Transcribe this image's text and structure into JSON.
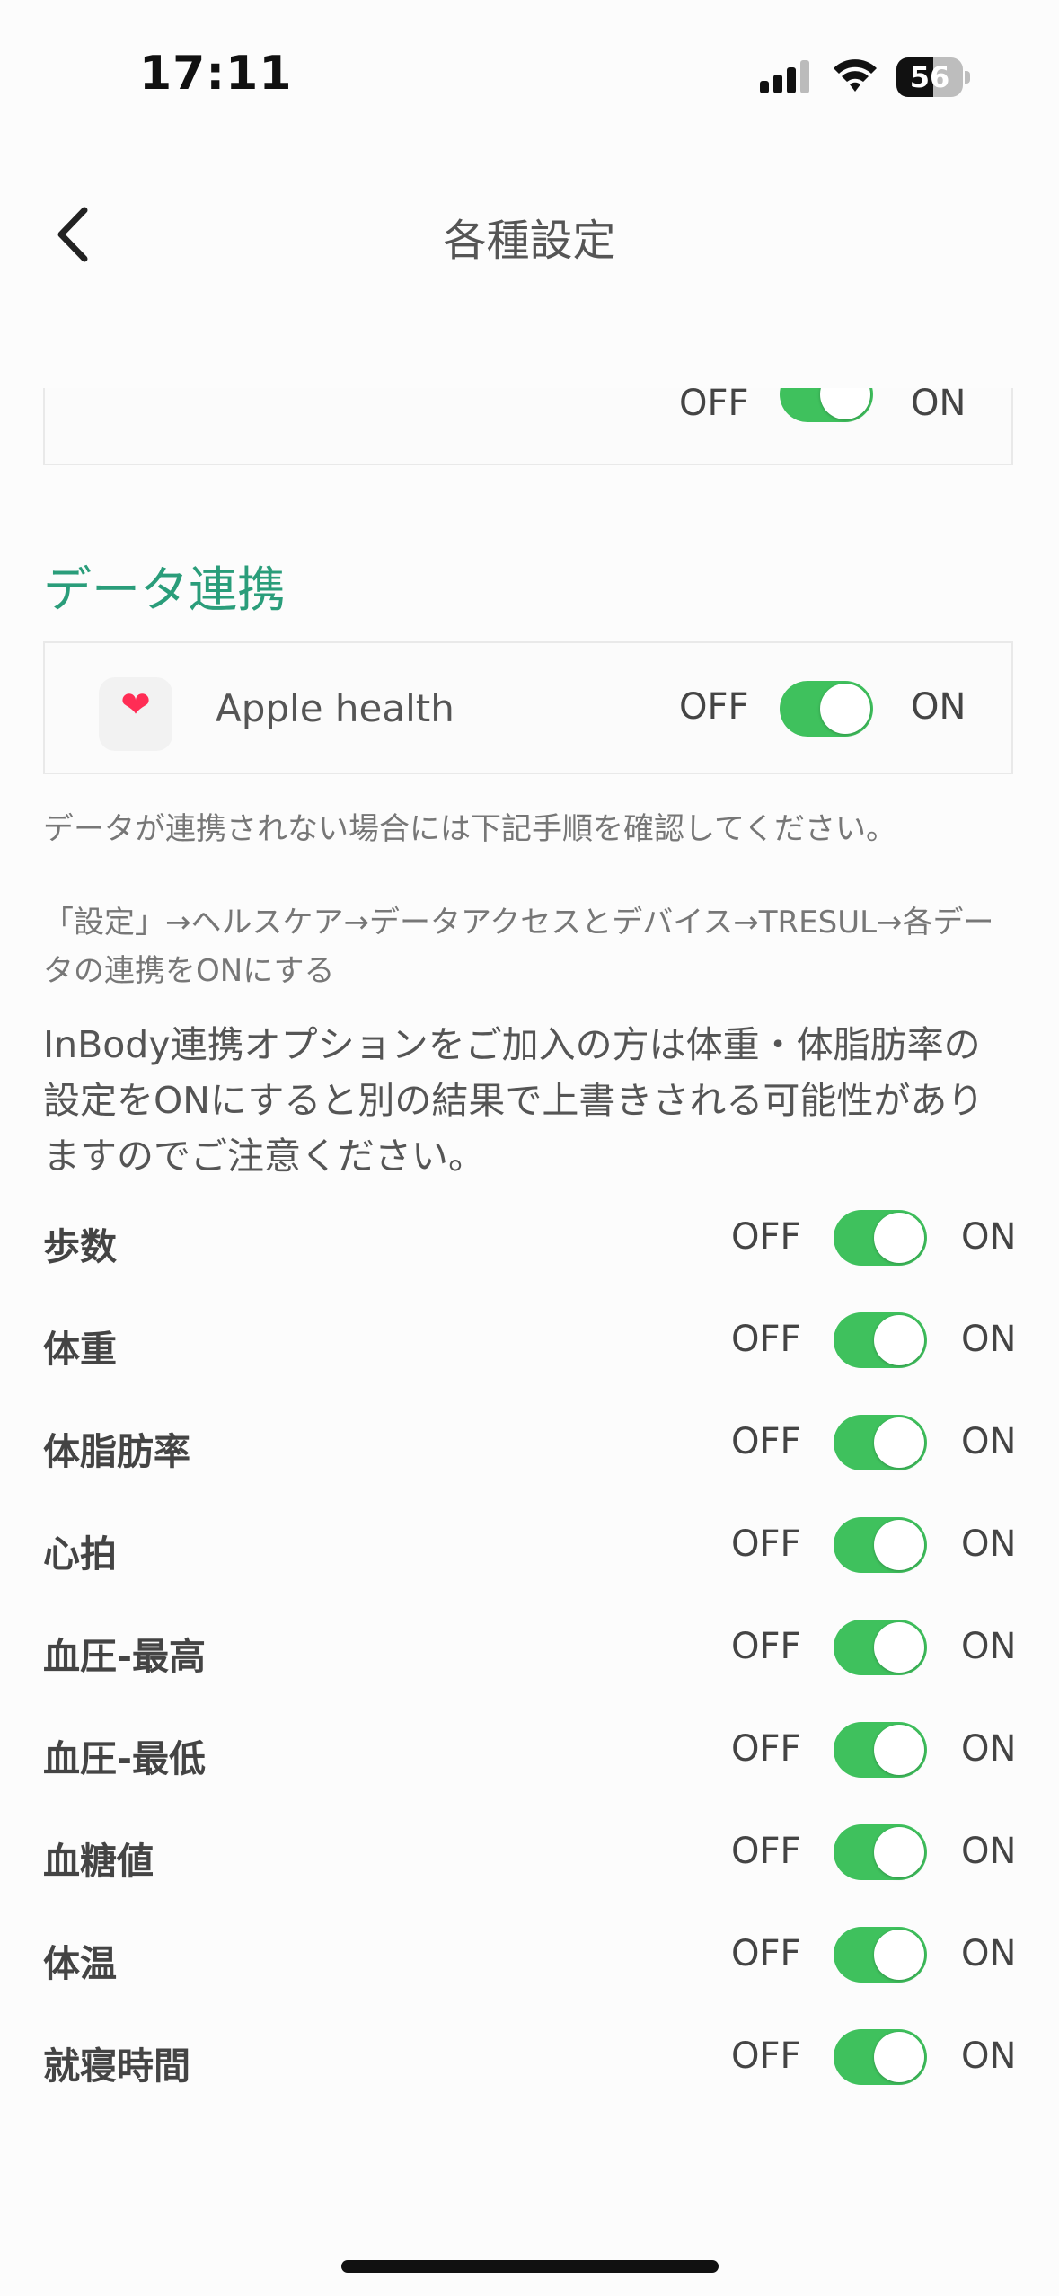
{
  "status_bar": {
    "time": "17:11",
    "battery_percent": "56",
    "battery_level": 0.56
  },
  "nav": {
    "title": "各種設定"
  },
  "top_card": {
    "off_label": "OFF",
    "on_label": "ON",
    "toggle_on": true
  },
  "data_link": {
    "section_title": "データ連携",
    "apple_health": {
      "label": "Apple health",
      "off_label": "OFF",
      "on_label": "ON",
      "toggle_on": true
    }
  },
  "notes": {
    "note1": "データが連携されない場合には下記手順を確認してください。",
    "note2": "「設定」→ヘルスケア→データアクセスとデバイス→TRESUL→各データの連携をONにする",
    "note3": "InBody連携オプションをご加入の方は体重・体脂肪率の設定をONにすると別の結果で上書きされる可能性がありますのでご注意ください。"
  },
  "settings": [
    {
      "label": "歩数",
      "off_label": "OFF",
      "on_label": "ON",
      "toggle_on": true
    },
    {
      "label": "体重",
      "off_label": "OFF",
      "on_label": "ON",
      "toggle_on": true
    },
    {
      "label": "体脂肪率",
      "off_label": "OFF",
      "on_label": "ON",
      "toggle_on": true
    },
    {
      "label": "心拍",
      "off_label": "OFF",
      "on_label": "ON",
      "toggle_on": true
    },
    {
      "label": "血圧-最高",
      "off_label": "OFF",
      "on_label": "ON",
      "toggle_on": true
    },
    {
      "label": "血圧-最低",
      "off_label": "OFF",
      "on_label": "ON",
      "toggle_on": true
    },
    {
      "label": "血糖値",
      "off_label": "OFF",
      "on_label": "ON",
      "toggle_on": true
    },
    {
      "label": "体温",
      "off_label": "OFF",
      "on_label": "ON",
      "toggle_on": true
    },
    {
      "label": "就寝時間",
      "off_label": "OFF",
      "on_label": "ON",
      "toggle_on": true
    }
  ],
  "colors": {
    "accent": "#2a9d7a",
    "toggle_on": "#3fc15d"
  }
}
